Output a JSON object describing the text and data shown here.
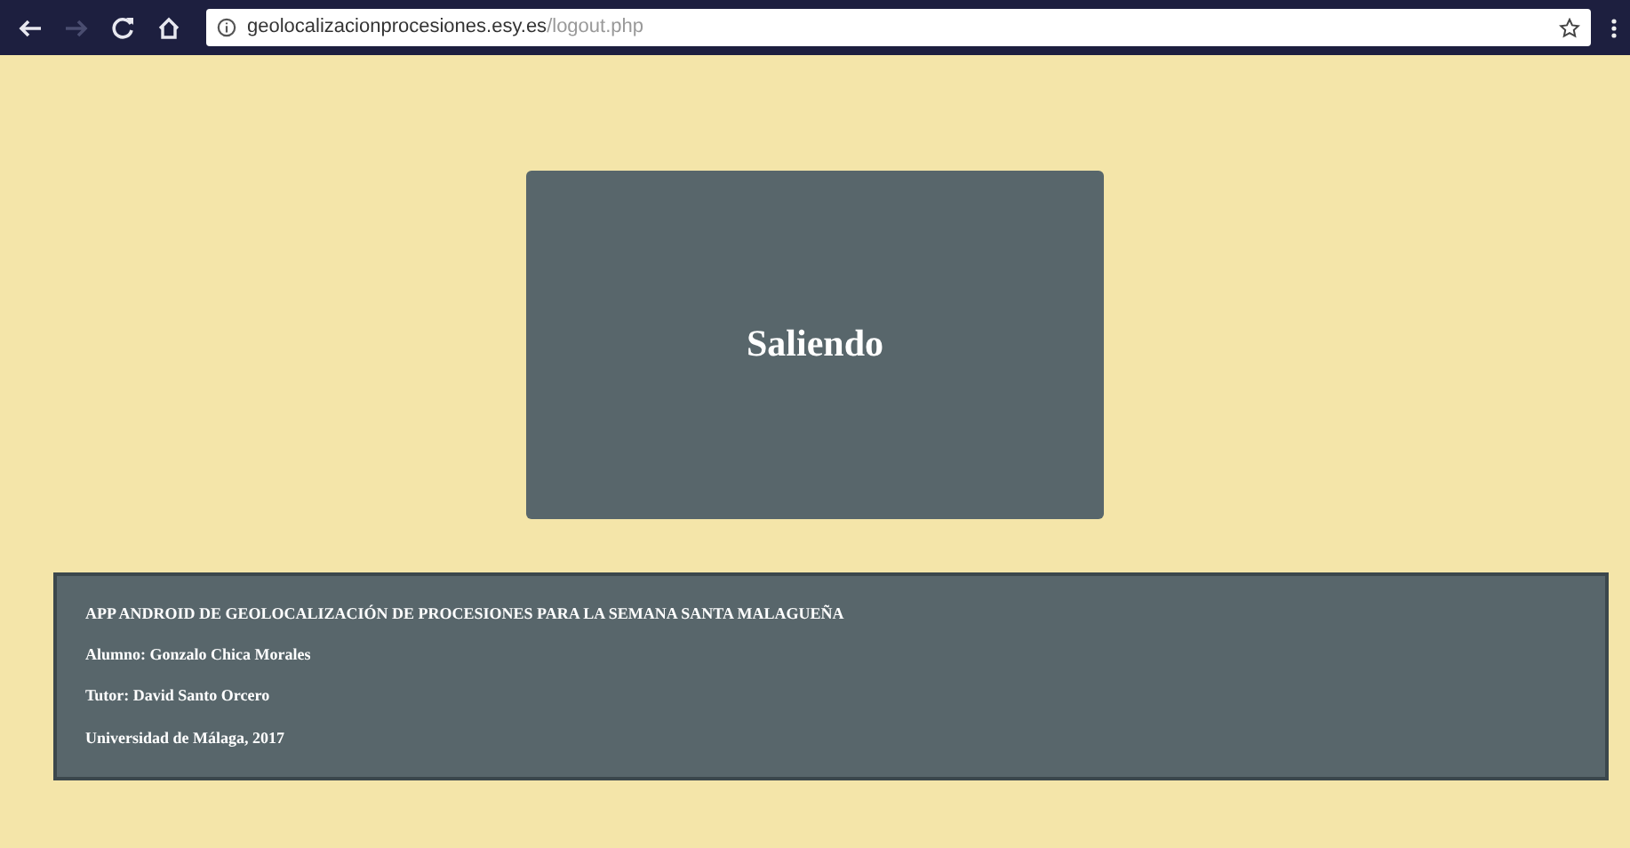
{
  "browser": {
    "nav_buttons": [
      {
        "kind": "back",
        "disabled": false
      },
      {
        "kind": "forward",
        "disabled": true
      },
      {
        "kind": "reload",
        "disabled": false
      },
      {
        "kind": "home",
        "disabled": false
      }
    ],
    "url": {
      "host": "geolocalizacionprocesiones.esy.es",
      "path": "/logout.php"
    }
  },
  "message": {
    "title": "Saliendo"
  },
  "footer": {
    "lines": [
      "APP ANDROID DE GEOLOCALIZACIÓN DE PROCESIONES PARA LA SEMANA SANTA MALAGUEÑA",
      "Alumno: Gonzalo Chica Morales",
      "Tutor: David Santo Orcero",
      "Universidad de Málaga, 2017"
    ]
  }
}
